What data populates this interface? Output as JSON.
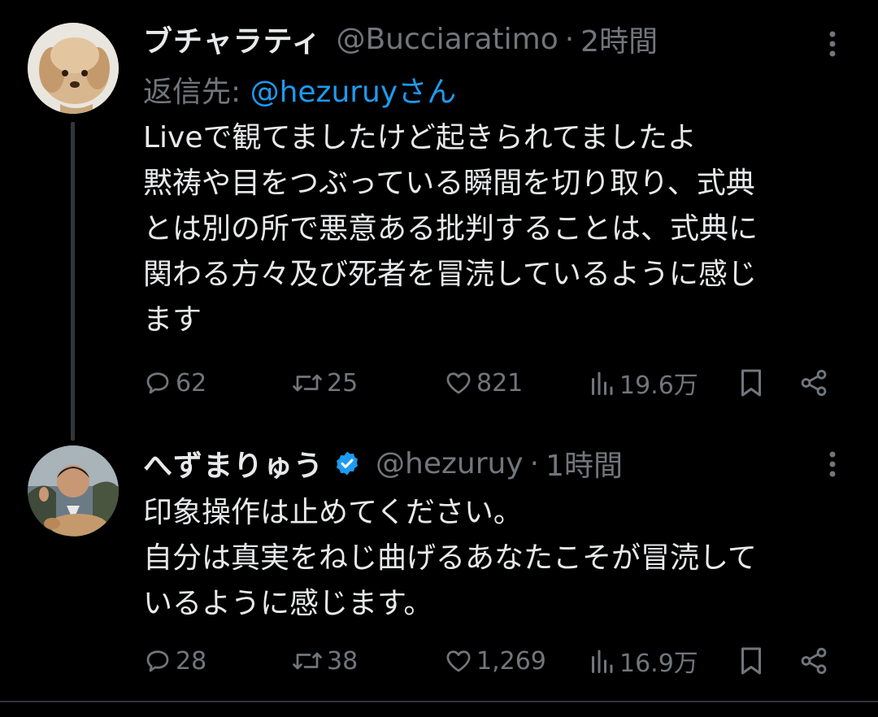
{
  "tweets": [
    {
      "name": "ブチャラティ",
      "handle": "@Bucciaratimo",
      "dot": "·",
      "time": "2時間",
      "verified": false,
      "reply_prefix": "返信先: ",
      "reply_mention": "@hezuruy",
      "reply_suffix": "さん",
      "body": [
        "Liveで観てましたけど起きられてましたよ",
        "黙祷や目をつぶっている瞬間を切り取り、式典",
        "とは別の所で悪意ある批判することは、式典に",
        "関わる方々及び死者を冒涜しているように感じ",
        "ます"
      ],
      "stats": {
        "replies": "62",
        "reposts": "25",
        "likes": "821",
        "views": "19.6万"
      },
      "avatar_icon": "dog-avatar"
    },
    {
      "name": "へずまりゅう",
      "handle": "@hezuruy",
      "dot": "·",
      "time": "1時間",
      "verified": true,
      "body": [
        "印象操作は止めてください。",
        "自分は真実をねじ曲げるあなたこそが冒涜して",
        "いるように感じます。"
      ],
      "stats": {
        "replies": "28",
        "reposts": "38",
        "likes": "1,269",
        "views": "16.9万"
      },
      "avatar_icon": "man-with-deer-avatar"
    }
  ],
  "colors": {
    "background": "#000000",
    "text": "#e7e9ea",
    "muted": "#71767b",
    "accent": "#1d9bf0"
  }
}
